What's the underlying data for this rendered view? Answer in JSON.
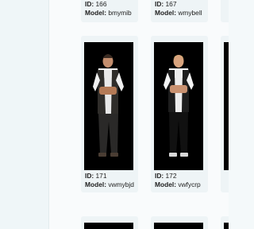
{
  "cards": [
    {
      "id_label": "ID:",
      "id": "166",
      "model_label": "Model:",
      "model": "bmymib"
    },
    {
      "id_label": "ID:",
      "id": "167",
      "model_label": "Model:",
      "model": "wmybell"
    },
    {
      "id_label": "ID:",
      "id": "171",
      "model_label": "Model:",
      "model": "vwmybjd"
    },
    {
      "id_label": "ID:",
      "id": "172",
      "model_label": "Model:",
      "model": "vwfycrp"
    }
  ]
}
